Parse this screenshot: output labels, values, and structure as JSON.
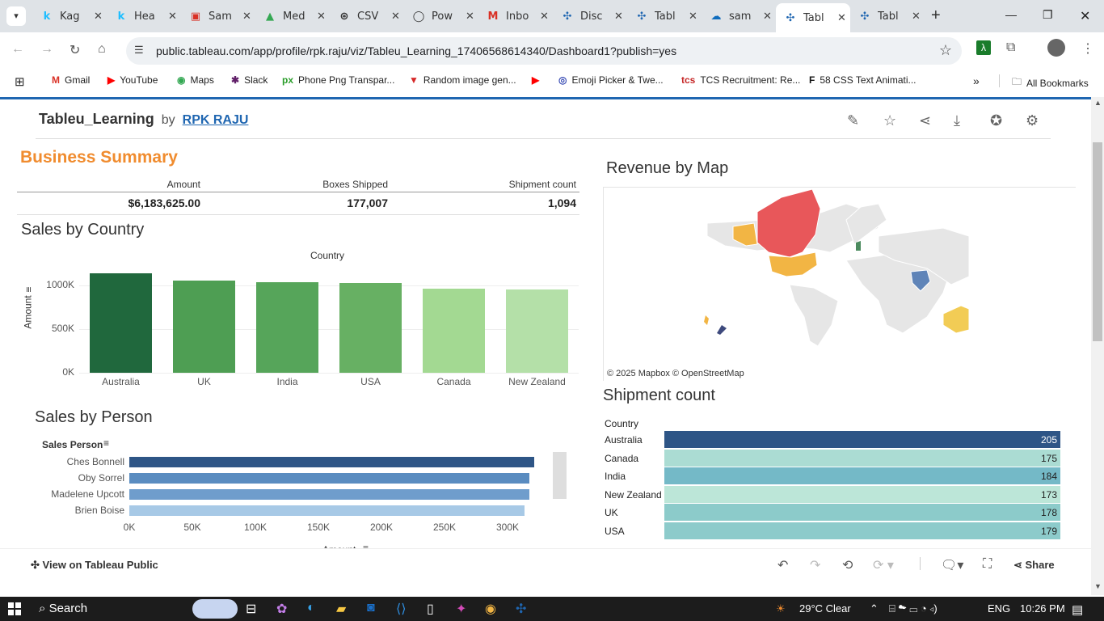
{
  "browser": {
    "tabs": [
      {
        "label": "Kag",
        "icon": "k",
        "color": "#20beff"
      },
      {
        "label": "Hea",
        "icon": "k",
        "color": "#20beff"
      },
      {
        "label": "Sam",
        "icon": "▣",
        "color": "#d93025"
      },
      {
        "label": "Med",
        "icon": "▲",
        "color": "#34a853"
      },
      {
        "label": "CSV",
        "icon": "⊛",
        "color": "#333333"
      },
      {
        "label": "Pow",
        "icon": "◯",
        "color": "#333333"
      },
      {
        "label": "Inbo",
        "icon": "M",
        "color": "#d93025"
      },
      {
        "label": "Disc",
        "icon": "✣",
        "color": "#1f66b1"
      },
      {
        "label": "Tabl",
        "icon": "✣",
        "color": "#1f66b1"
      },
      {
        "label": "sam",
        "icon": "☁",
        "color": "#0f6cbd"
      },
      {
        "label": "Tabl",
        "icon": "✣",
        "color": "#1f66b1",
        "active": true
      },
      {
        "label": "Tabl",
        "icon": "✣",
        "color": "#1f66b1"
      }
    ],
    "url": "public.tableau.com/app/profile/rpk.raju/viz/Tableu_Learning_17406568614340/Dashboard1?publish=yes",
    "bookmarks": [
      {
        "label": "Gmail",
        "icon": "M",
        "color": "#d93025"
      },
      {
        "label": "YouTube",
        "icon": "▶",
        "color": "#ff0000"
      },
      {
        "label": "Maps",
        "icon": "◉",
        "color": "#34a853"
      },
      {
        "label": "Slack",
        "icon": "✱",
        "color": "#611f69"
      },
      {
        "label": "Phone Png Transpar...",
        "icon": "px",
        "color": "#2a9d2a"
      },
      {
        "label": "Random image gen...",
        "icon": "▼",
        "color": "#d62828"
      },
      {
        "label": "",
        "icon": "▶",
        "color": "#ff0000"
      },
      {
        "label": "Emoji Picker & Twe...",
        "icon": "◎",
        "color": "#3a4db5"
      },
      {
        "label": "TCS Recruitment: Re...",
        "icon": "tcs",
        "color": "#c62828"
      },
      {
        "label": "58 CSS Text Animati...",
        "icon": "F",
        "color": "#111111"
      }
    ],
    "all_bookmarks": "All Bookmarks"
  },
  "viz": {
    "title": "Tableu_Learning",
    "by": "by",
    "author": "RPK RAJU"
  },
  "business": {
    "title": "Business Summary",
    "headers": [
      "Amount",
      "Boxes Shipped",
      "Shipment count"
    ],
    "values": [
      "$6,183,625.00",
      "177,007",
      "1,094"
    ]
  },
  "sales_country_title": "Sales by Country",
  "revenue_map_title": "Revenue by Map",
  "map_attribution": "© 2025 Mapbox  © OpenStreetMap",
  "sales_person_title": "Sales by Person",
  "shipment_title": "Shipment count",
  "chart_data": [
    {
      "type": "bar",
      "title": "Sales by Country",
      "xlabel": "Country",
      "ylabel": "Amount",
      "categories": [
        "Australia",
        "UK",
        "India",
        "USA",
        "Canada",
        "New Zealand"
      ],
      "values": [
        1137000,
        1051000,
        1036000,
        1024000,
        963000,
        950000
      ],
      "colors": [
        "#20683d",
        "#4e9e53",
        "#56a55a",
        "#67b063",
        "#a3d992",
        "#b4e0a8"
      ],
      "yticks": [
        "0K",
        "500K",
        "1000K"
      ],
      "ylim": [
        0,
        1200000
      ]
    },
    {
      "type": "bar",
      "orientation": "horizontal",
      "title": "Sales by Person",
      "ylabel": "Sales Person",
      "xlabel": "Amount",
      "categories": [
        "Ches Bonnell",
        "Oby Sorrel",
        "Madelene Upcott",
        "Brien Boise"
      ],
      "values": [
        320000,
        316000,
        316000,
        312000
      ],
      "colors": [
        "#2e5586",
        "#5a8cc0",
        "#6f9dcc",
        "#a7c9e6"
      ],
      "xticks": [
        "0K",
        "50K",
        "100K",
        "150K",
        "200K",
        "250K",
        "300K"
      ],
      "xlim": [
        0,
        350000
      ]
    },
    {
      "type": "table",
      "title": "Shipment count",
      "column": "Country",
      "rows": [
        {
          "country": "Australia",
          "value": 205,
          "color": "#2e5586"
        },
        {
          "country": "Canada",
          "value": 175,
          "color": "#abdcd3"
        },
        {
          "country": "India",
          "value": 184,
          "color": "#74b9c7"
        },
        {
          "country": "New Zealand",
          "value": 173,
          "color": "#bce6d8"
        },
        {
          "country": "UK",
          "value": 178,
          "color": "#8ccbca"
        },
        {
          "country": "USA",
          "value": 179,
          "color": "#8dcbcb"
        }
      ]
    }
  ],
  "footer": {
    "view_on": "View on Tableau Public",
    "share": "Share"
  },
  "taskbar": {
    "search": "Search",
    "weather": "29°C  Clear",
    "lang": "ENG",
    "time": "10:26 PM"
  }
}
